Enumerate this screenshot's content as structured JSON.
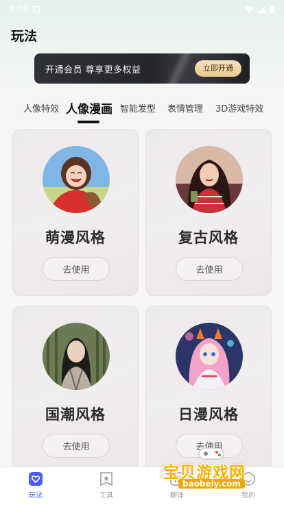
{
  "status_bar": {
    "time": "9:46"
  },
  "header": {
    "title": "玩法"
  },
  "vip_banner": {
    "text": "开通会员  尊享更多权益",
    "button_label": "立即开通"
  },
  "tabs": [
    {
      "label": "人像特效",
      "active": false
    },
    {
      "label": "人像漫画",
      "active": true
    },
    {
      "label": "智能发型",
      "active": false
    },
    {
      "label": "表情管理",
      "active": false
    },
    {
      "label": "3D游戏特效",
      "active": false
    }
  ],
  "cards": [
    {
      "name": "萌漫风格",
      "button_label": "去使用"
    },
    {
      "name": "复古风格",
      "button_label": "去使用"
    },
    {
      "name": "国潮风格",
      "button_label": "去使用"
    },
    {
      "name": "日漫风格",
      "button_label": "去使用"
    }
  ],
  "bottom_nav": [
    {
      "label": "玩法",
      "icon": "heart-icon",
      "active": true
    },
    {
      "label": "工具",
      "icon": "star-icon",
      "active": false
    },
    {
      "label": "翻译",
      "icon": "translate-icon",
      "active": false
    },
    {
      "label": "我的",
      "icon": "user-icon",
      "active": false
    }
  ],
  "watermark": {
    "text": "宝贝游戏网",
    "url": "baobeiy.com"
  },
  "colors": {
    "accent": "#4b5bff",
    "vip_gold": "#e9c98f",
    "banner_dark": "#26282d"
  }
}
